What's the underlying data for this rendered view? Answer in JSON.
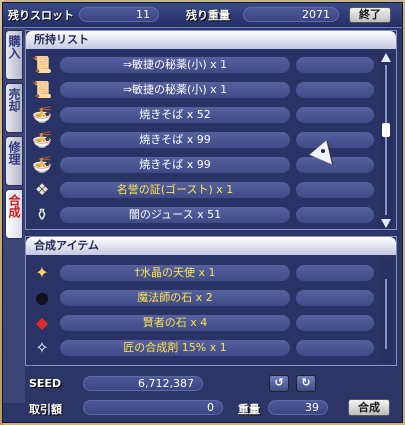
{
  "header": {
    "slots_label": "残りスロット",
    "slots_value": "11",
    "weight_label": "残り重量",
    "weight_value": "2071",
    "close_label": "終了"
  },
  "tabs": [
    {
      "label": "購入",
      "active": false
    },
    {
      "label": "売却",
      "active": false
    },
    {
      "label": "修理",
      "active": false
    },
    {
      "label": "合成",
      "active": true
    }
  ],
  "inventory": {
    "title": "所持リスト",
    "items": [
      {
        "icon": "book-icon",
        "glyph": "📜",
        "text": "⇒敏捷の秘薬(小) x 1",
        "color": "white"
      },
      {
        "icon": "book-icon",
        "glyph": "📜",
        "text": "⇒敏捷の秘薬(小) x 1",
        "color": "white"
      },
      {
        "icon": "yakisoba-icon",
        "glyph": "🍜",
        "text": "焼きそば x 52",
        "color": "white"
      },
      {
        "icon": "yakisoba-icon",
        "glyph": "🍜",
        "text": "焼きそば x 99",
        "color": "white"
      },
      {
        "icon": "yakisoba-icon",
        "glyph": "🍜",
        "text": "焼きそば x 99",
        "color": "white"
      },
      {
        "icon": "certificate-icon",
        "glyph": "❖",
        "text": "名誉の証(ゴースト) x 1",
        "color": "yellow"
      },
      {
        "icon": "juice-icon",
        "glyph": "⚱",
        "text": "闇のジュース x 51",
        "color": "white"
      }
    ]
  },
  "synthesis": {
    "title": "合成アイテム",
    "items": [
      {
        "icon": "wand-icon",
        "glyph": "✦",
        "text": "†水晶の天使 x 1",
        "color": "yellow"
      },
      {
        "icon": "dark-stone-icon",
        "glyph": "●",
        "text": "魔法師の石 x 2",
        "color": "yellow"
      },
      {
        "icon": "red-stone-icon",
        "glyph": "◆",
        "text": "賢者の石 x 4",
        "color": "yellow"
      },
      {
        "icon": "sparkle-icon",
        "glyph": "✧",
        "text": "匠の合成剤 15% x 1",
        "color": "yellow"
      }
    ]
  },
  "footer": {
    "seed_label": "SEED",
    "seed_value": "6,712,387",
    "fee_label": "取引額",
    "fee_value": "0",
    "weight_label": "重量",
    "weight_value": "39",
    "synthesize_label": "合成"
  },
  "colors": {
    "panel_bg": "#2a3366",
    "pill": "#4b5894",
    "yellow_text": "#ffe34a",
    "tab_active_text": "#d11a1a"
  }
}
